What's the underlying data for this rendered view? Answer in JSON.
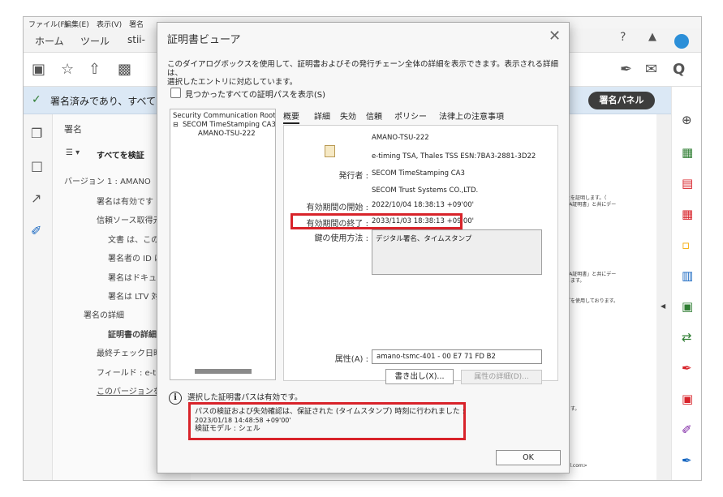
{
  "menubar": {
    "items": [
      "ファイル(F)",
      "編集(E)",
      "表示(V)",
      "署名"
    ]
  },
  "tabs": {
    "home": "ホーム",
    "tools": "ツール",
    "doc": "stii-"
  },
  "sigbar": {
    "message": "署名済みであり、すべて",
    "panel_button": "署名パネル"
  },
  "sig_panel": {
    "title": "署名",
    "verify_all": "すべてを検証",
    "rows": [
      "バージョン 1 : AMANO",
      "署名は有効です :",
      "信頼ソース取得元",
      "文書 は、この",
      "署名者の ID は",
      "署名はドキュメ",
      "署名は LTV 対",
      "署名の詳細",
      "証明書の詳細",
      "最終チェック日時",
      "フィールド : e-timin",
      "このバージョンを表"
    ]
  },
  "doc_fragments": [
    "性を証明します。（",
    "CA証明書」と共にデー",
    "CA証明書」と共にデー",
    "します。",
    "プを使用しております。",
    "ます。",
    "ail.com>"
  ],
  "dialog": {
    "title": "証明書ビューア",
    "description_line1": "このダイアログボックスを使用して、証明書およびその発行チェーン全体の詳細を表示できます。表示される詳細は、",
    "description_line2": "選択したエントリに対応しています。",
    "show_all_paths": "見つかったすべての証明パスを表示(S)",
    "tree": [
      "Security Communication RootC",
      "SECOM TimeStamping CA3",
      "AMANO-TSU-222"
    ],
    "tabs": [
      "概要",
      "詳細",
      "失効",
      "信頼",
      "ポリシー",
      "法律上の注意事項"
    ],
    "summary": {
      "subject": "AMANO-TSU-222",
      "subject_detail": "e-timing TSA, Thales TSS ESN:7BA3-2881-3D22",
      "issuer_label": "発行者 :",
      "issuer_1": "SECOM TimeStamping CA3",
      "issuer_2": "SECOM Trust Systems CO.,LTD.",
      "valid_from_label": "有効期間の開始 :",
      "valid_from": "2022/10/04 18:38:13 +09'00'",
      "valid_to_label": "有効期間の終了 :",
      "valid_to": "2033/11/03 18:38:13 +09'00'",
      "key_usage_label": "鍵の使用方法 :",
      "key_usage": "デジタル署名、タイムスタンプ",
      "attribute_label": "属性(A) :",
      "attribute": "amano-tsmc-401 - 00 E7 71 FD B2",
      "attribute_details": "属性の詳細(D)..."
    },
    "export": "書き出し(X)...",
    "valid_message": "選択した証明書パスは有効です。",
    "verify_line1": "パスの検証および失効確認は、保証された (タイムスタンプ) 時刻に行われました :",
    "verify_time": "2023/01/18 14:48:58 +09'00'",
    "verify_model": "検証モデル : シェル",
    "ok": "OK"
  },
  "colors": {
    "highlight": "#d8232a",
    "sigbar_bg": "#dbe8f5",
    "panel_button": "#3d3d3d"
  }
}
